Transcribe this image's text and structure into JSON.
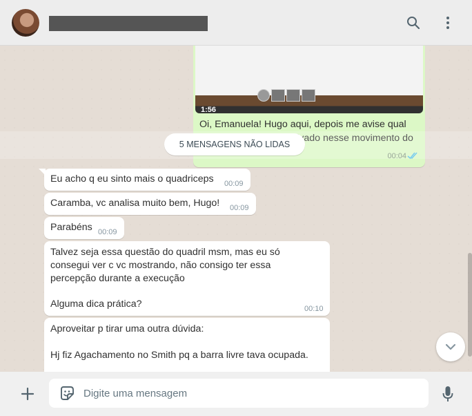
{
  "header": {
    "contact_name": "",
    "icons": [
      "search-icon",
      "menu-icon"
    ]
  },
  "outgoing_message": {
    "video_duration": "1:56",
    "text": "Oi, Emanuela! Hugo aqui, depois me avise qual músculo sente mais ativado nesse movimento do Levantamento Terra?",
    "time": "00:04",
    "status": "read"
  },
  "unread_divider": "5 MENSAGENS NÃO LIDAS",
  "incoming_messages": [
    {
      "text": "Eu acho q eu sinto mais o quadriceps",
      "time": "00:09"
    },
    {
      "text": "Caramba, vc analisa muito bem, Hugo!",
      "time": "00:09"
    },
    {
      "text": "Parabéns",
      "time": "00:09"
    },
    {
      "text_lines": [
        "Talvez seja essa questão do quadril msm, mas eu só",
        "consegui ver c vc mostrando, não consigo ter essa",
        "percepção durante a execução",
        "",
        "Alguma dica prática?"
      ],
      "time": "00:10"
    },
    {
      "text_lines": [
        "Aproveitar p tirar uma outra dúvida:",
        "",
        "Hj fiz Agachamento no Smith pq a barra livre tava ocupada."
      ]
    }
  ],
  "composer": {
    "placeholder": "Digite uma mensagem"
  },
  "colors": {
    "outgoing_bubble": "#dcf8c6",
    "incoming_bubble": "#ffffff",
    "chat_background": "#e5ddd5",
    "read_ticks": "#53bdeb"
  }
}
